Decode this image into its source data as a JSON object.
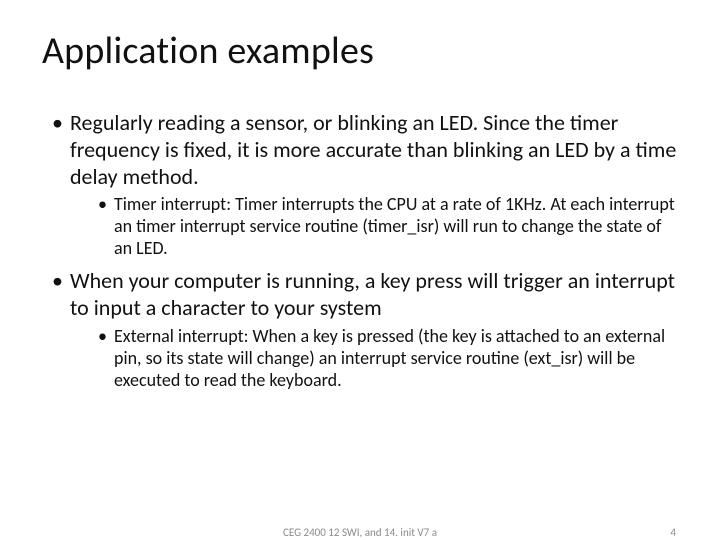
{
  "title": "Application examples",
  "bullets": [
    {
      "text": "Regularly reading a sensor, or blinking an LED. Since the timer frequency is fixed, it is more accurate than blinking an LED by a time delay method.",
      "sub": [
        "Timer interrupt: Timer interrupts the CPU at a rate of 1KHz. At each interrupt an timer interrupt service routine (timer_isr) will run to change the state of an LED."
      ]
    },
    {
      "text": "When your computer is running, a key press will trigger an interrupt to input a character to your system",
      "sub": [
        "External interrupt: When a key is pressed (the key is attached to an external pin, so its state will change) an interrupt service routine (ext_isr) will be executed to read the keyboard."
      ]
    }
  ],
  "footer": {
    "center": "CEG 2400 12 SWI, and 14. init V7 a",
    "page": "4"
  }
}
